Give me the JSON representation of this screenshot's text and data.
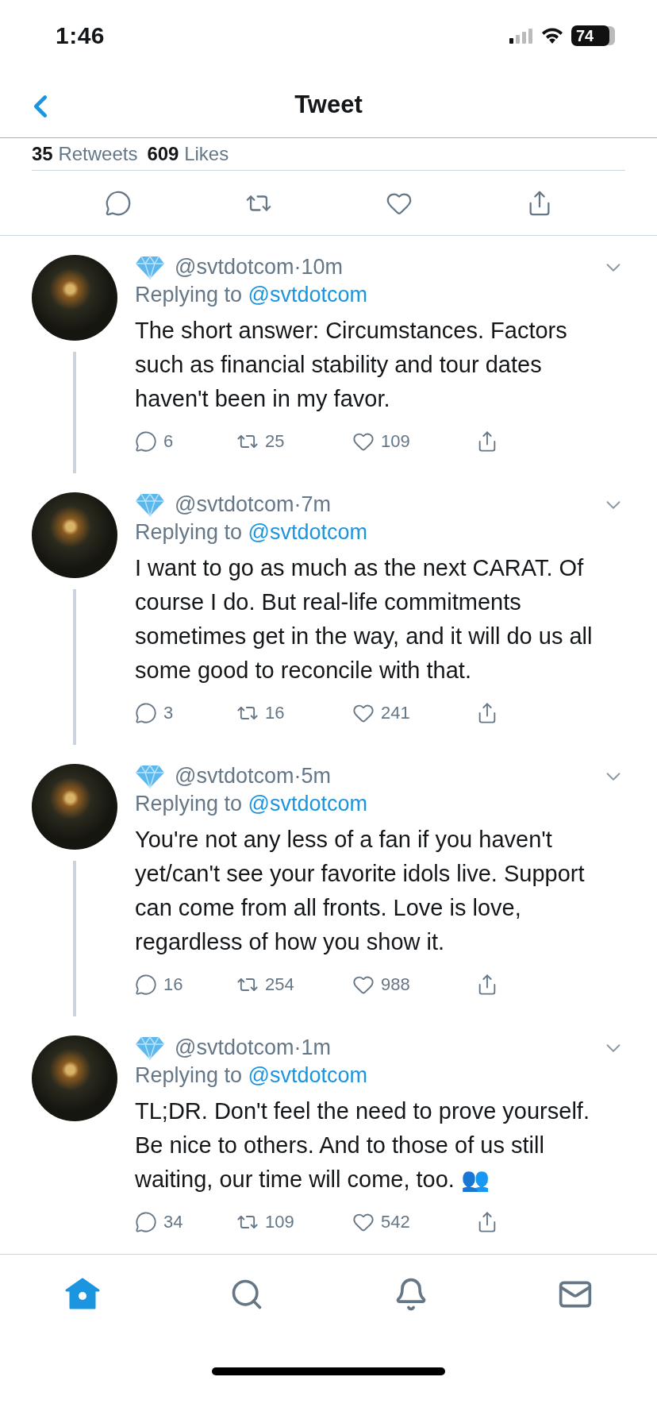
{
  "status_bar": {
    "time": "1:46",
    "battery": "74"
  },
  "header": {
    "title": "Tweet"
  },
  "stats": [
    {
      "count": "35",
      "label": "Retweets"
    },
    {
      "count": "609",
      "label": "Likes"
    }
  ],
  "actions": [
    {
      "kind": "reply"
    },
    {
      "kind": "retweet"
    },
    {
      "kind": "like"
    },
    {
      "kind": "share"
    }
  ],
  "replies": [
    {
      "handle": "@svtdotcom",
      "separator": "·",
      "time": "10m",
      "replying_label": "Replying to",
      "replying_to": "@svtdotcom",
      "text": "The short answer: Circumstances. Factors such as financial stability and tour dates haven't been in my favor.",
      "replies": "6",
      "retweets": "25",
      "likes": "109",
      "thread_below": true
    },
    {
      "handle": "@svtdotcom",
      "separator": "·",
      "time": "7m",
      "replying_label": "Replying to",
      "replying_to": "@svtdotcom",
      "text": "I want to go as much as the next CARAT. Of course I do. But real-life commitments sometimes get in the way, and it will do us all some good to reconcile with that.",
      "replies": "3",
      "retweets": "16",
      "likes": "241",
      "thread_below": true
    },
    {
      "handle": "@svtdotcom",
      "separator": "·",
      "time": "5m",
      "replying_label": "Replying to",
      "replying_to": "@svtdotcom",
      "text": "You're not any less of a fan if you haven't yet/can't see your favorite idols live. Support can come from all fronts. Love is love, regardless of how you show it.",
      "replies": "16",
      "retweets": "254",
      "likes": "988",
      "thread_below": true
    },
    {
      "handle": "@svtdotcom",
      "separator": "·",
      "time": "1m",
      "replying_label": "Replying to",
      "replying_to": "@svtdotcom",
      "text": "TL;DR. Don't feel the need to prove yourself. Be nice to others. And to those of us still waiting, our time will come, too. 👥",
      "replies": "34",
      "retweets": "109",
      "likes": "542",
      "thread_below": false
    }
  ],
  "tab_bar": [
    {
      "kind": "home",
      "selected": true
    },
    {
      "kind": "search",
      "selected": false
    },
    {
      "kind": "notifications",
      "selected": false
    },
    {
      "kind": "messages",
      "selected": false
    }
  ]
}
